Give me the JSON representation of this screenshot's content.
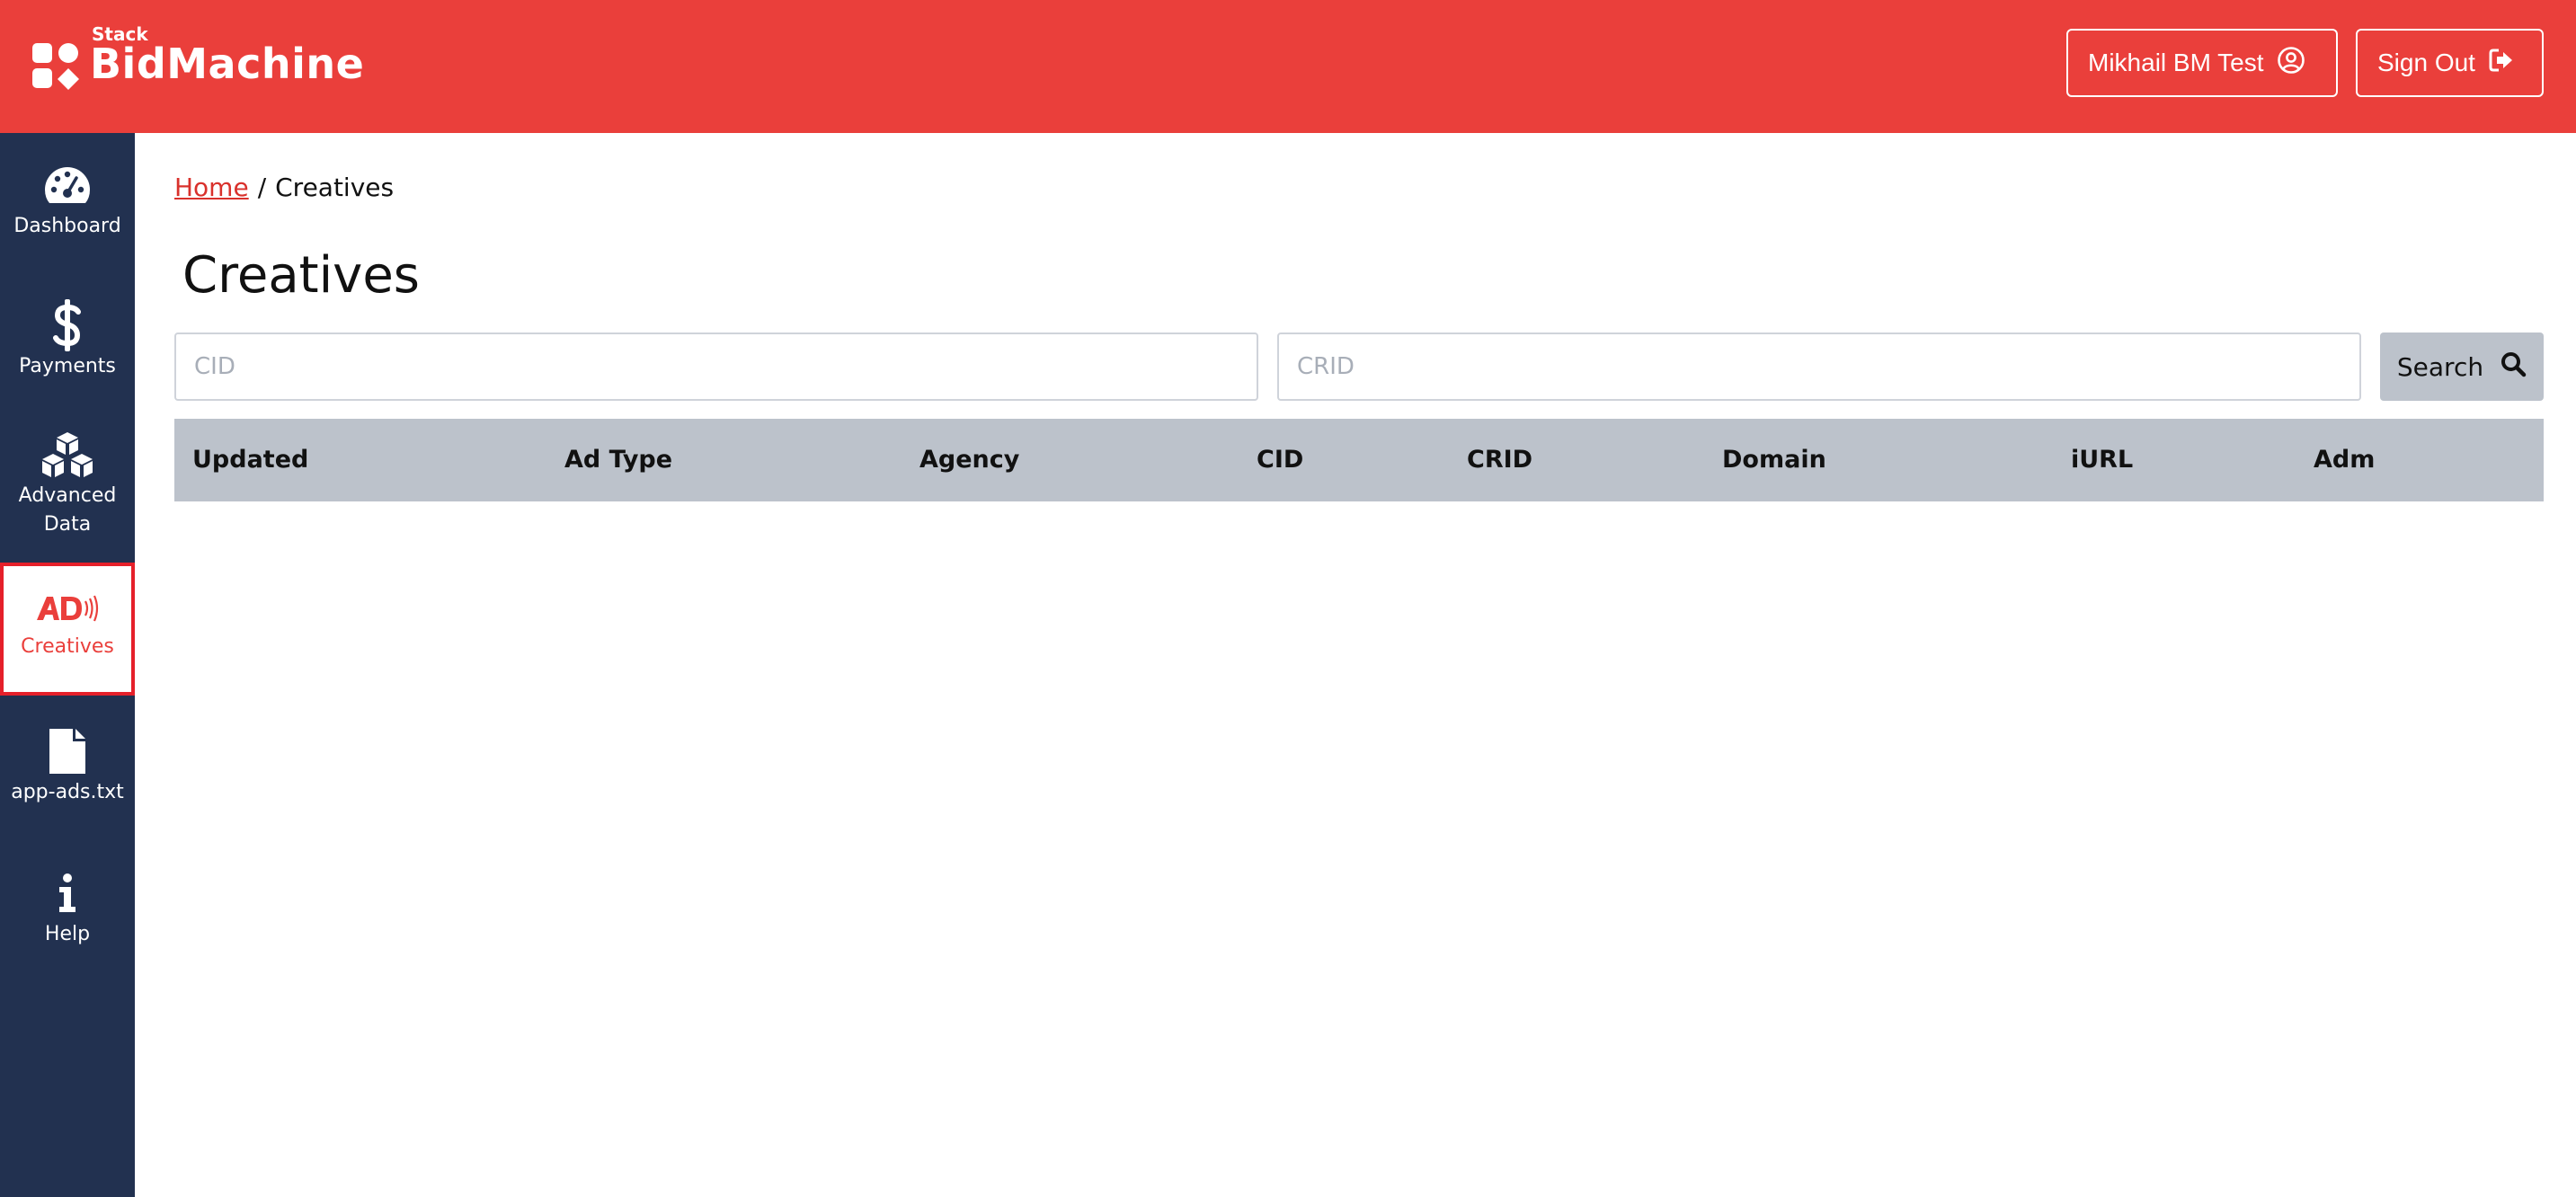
{
  "brand": {
    "small": "Stack",
    "name": "BidMachine"
  },
  "header": {
    "user_label": "Mikhail BM Test",
    "signout_label": "Sign Out"
  },
  "sidebar": {
    "items": [
      {
        "label": "Dashboard",
        "icon": "dashboard-gauge-icon"
      },
      {
        "label": "Payments",
        "icon": "dollar-icon"
      },
      {
        "label": "Advanced Data",
        "icon": "cubes-icon"
      },
      {
        "label": "Creatives",
        "icon": "ad-icon",
        "active": true
      },
      {
        "label": "app-ads.txt",
        "icon": "file-icon"
      },
      {
        "label": "Help",
        "icon": "info-icon"
      }
    ]
  },
  "breadcrumb": {
    "home": "Home",
    "separator": "/",
    "current": "Creatives"
  },
  "page": {
    "title": "Creatives"
  },
  "search": {
    "cid_placeholder": "CID",
    "cid_value": "",
    "crid_placeholder": "CRID",
    "crid_value": "",
    "button_label": "Search"
  },
  "table": {
    "columns": [
      "Updated",
      "Ad Type",
      "Agency",
      "CID",
      "CRID",
      "Domain",
      "iURL",
      "Adm"
    ],
    "rows": []
  },
  "colors": {
    "brand_red": "#ea3f3b",
    "sidebar_navy": "#223150",
    "table_header": "#bcc2cb"
  }
}
